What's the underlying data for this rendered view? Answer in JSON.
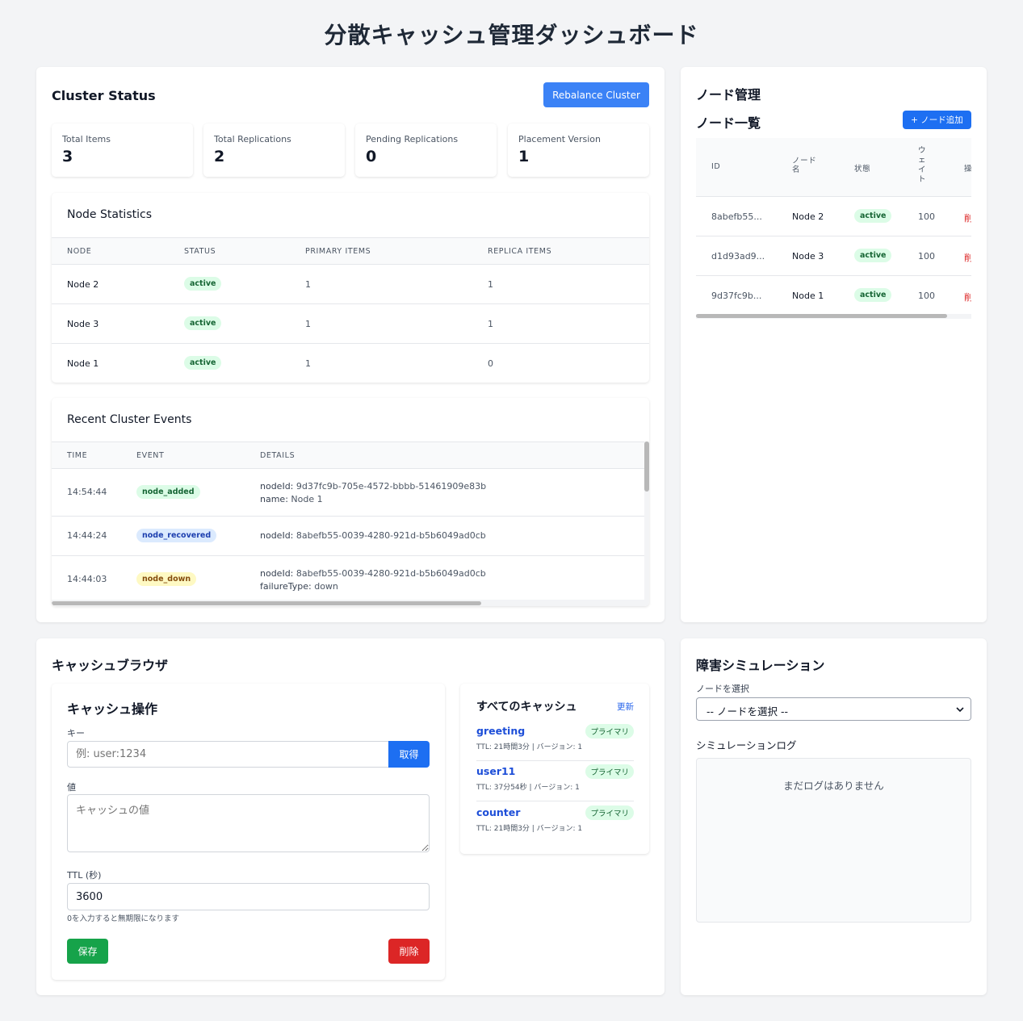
{
  "page": {
    "title": "分散キャッシュ管理ダッシュボード"
  },
  "cluster": {
    "title": "Cluster Status",
    "rebalance_label": "Rebalance Cluster",
    "stats": [
      {
        "label": "Total Items",
        "value": "3"
      },
      {
        "label": "Total Replications",
        "value": "2"
      },
      {
        "label": "Pending Replications",
        "value": "0"
      },
      {
        "label": "Placement Version",
        "value": "1"
      }
    ],
    "node_stats": {
      "title": "Node Statistics",
      "headers": [
        "NODE",
        "STATUS",
        "PRIMARY ITEMS",
        "REPLICA ITEMS"
      ],
      "rows": [
        {
          "node": "Node 2",
          "status": "active",
          "primary": "1",
          "replica": "1"
        },
        {
          "node": "Node 3",
          "status": "active",
          "primary": "1",
          "replica": "1"
        },
        {
          "node": "Node 1",
          "status": "active",
          "primary": "1",
          "replica": "0"
        }
      ]
    },
    "events": {
      "title": "Recent Cluster Events",
      "headers": [
        "TIME",
        "EVENT",
        "DETAILS"
      ],
      "rows": [
        {
          "time": "14:54:44",
          "event": "node_added",
          "line1_key": "nodeId:",
          "line1_val": " 9d37fc9b-705e-4572-bbbb-51461909e83b",
          "line2_key": "name:",
          "line2_val": " Node 1"
        },
        {
          "time": "14:44:24",
          "event": "node_recovered",
          "line1_key": "nodeId:",
          "line1_val": " 8abefb55-0039-4280-921d-b5b6049ad0cb",
          "line2_key": "",
          "line2_val": ""
        },
        {
          "time": "14:44:03",
          "event": "node_down",
          "line1_key": "nodeId:",
          "line1_val": " 8abefb55-0039-4280-921d-b5b6049ad0cb",
          "line2_key": "failureType:",
          "line2_val": " down"
        }
      ]
    }
  },
  "nodes": {
    "title": "ノード管理",
    "list_title": "ノード一覧",
    "add_label": "+ ノード追加",
    "headers": {
      "id": "ID",
      "name1": "ノード",
      "name2": "名",
      "status": "状態",
      "weight_chars": [
        "ウ",
        "ェ",
        "イ",
        "ト"
      ],
      "ops": "操"
    },
    "rows": [
      {
        "id": "8abefb55...",
        "name": "Node 2",
        "status": "active",
        "weight": "100",
        "op": "削"
      },
      {
        "id": "d1d93ad9...",
        "name": "Node 3",
        "status": "active",
        "weight": "100",
        "op": "削"
      },
      {
        "id": "9d37fc9b...",
        "name": "Node 1",
        "status": "active",
        "weight": "100",
        "op": "削"
      }
    ]
  },
  "browser": {
    "title": "キャッシュブラウザ",
    "ops": {
      "title": "キャッシュ操作",
      "key_label": "キー",
      "key_placeholder": "例: user:1234",
      "get_label": "取得",
      "value_label": "値",
      "value_placeholder": "キャッシュの値",
      "ttl_label": "TTL (秒)",
      "ttl_value": "3600",
      "ttl_hint": "0を入力すると無期限になります",
      "save_label": "保存",
      "delete_label": "削除"
    },
    "all": {
      "title": "すべてのキャッシュ",
      "refresh_label": "更新",
      "items": [
        {
          "key": "greeting",
          "badge": "プライマリ",
          "meta": "TTL: 21時間3分 | バージョン: 1"
        },
        {
          "key": "user11",
          "badge": "プライマリ",
          "meta": "TTL: 37分54秒 | バージョン: 1"
        },
        {
          "key": "counter",
          "badge": "プライマリ",
          "meta": "TTL: 21時間3分 | バージョン: 1"
        }
      ]
    }
  },
  "sim": {
    "title": "障害シミュレーション",
    "select_label": "ノードを選択",
    "select_value": "-- ノードを選択 --",
    "log_label": "シミュレーションログ",
    "log_empty": "まだログはありません"
  }
}
